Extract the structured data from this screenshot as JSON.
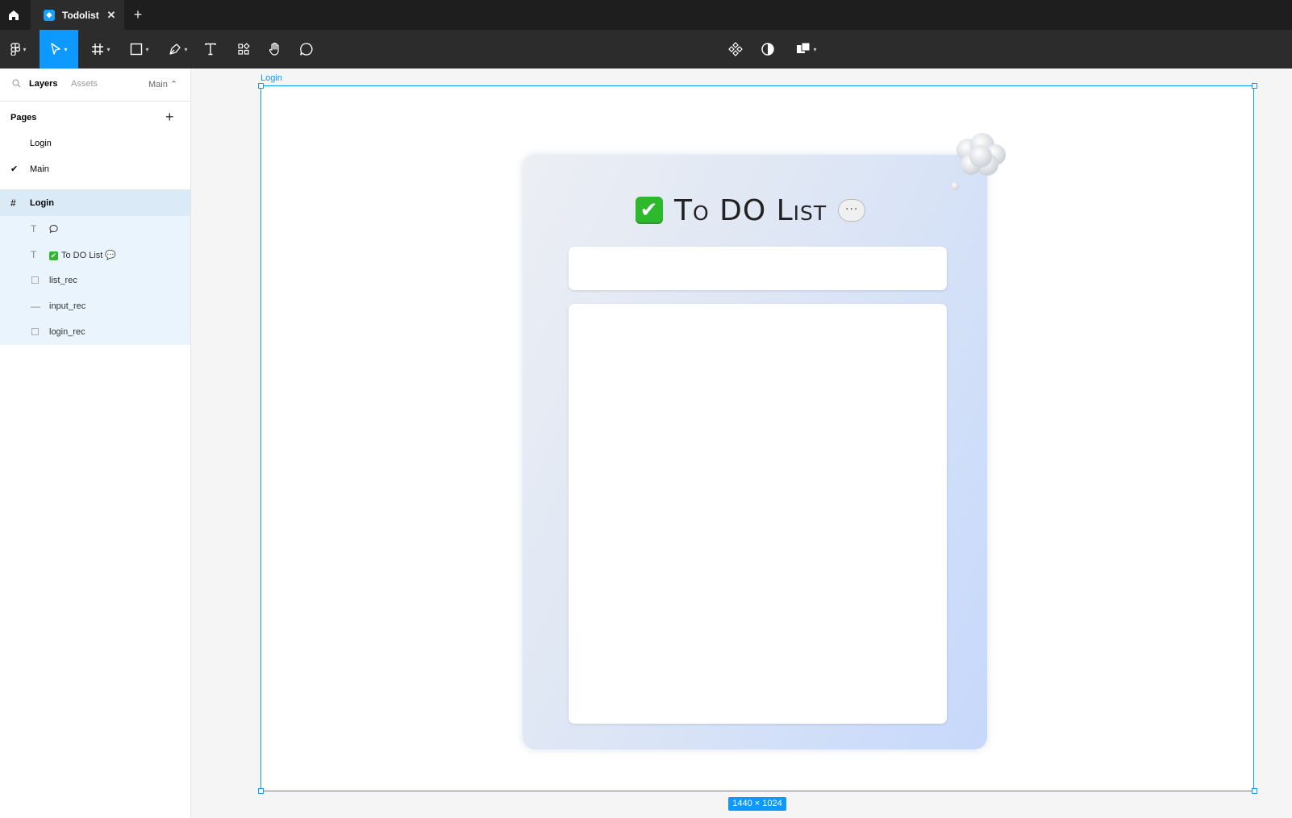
{
  "titlebar": {
    "tab_title": "Todolist",
    "close_glyph": "✕",
    "new_tab_glyph": "+"
  },
  "toolbar": {
    "tools": [
      "main-menu",
      "move-tool",
      "frame-tool",
      "shape-tool",
      "pen-tool",
      "text-tool",
      "resources-tool",
      "hand-tool",
      "comment-tool"
    ],
    "right_tools": [
      "components-icon",
      "mask-icon",
      "boolean-icon"
    ]
  },
  "left_panel": {
    "tabs": {
      "layers": "Layers",
      "assets": "Assets",
      "page_selector": "Main ⌃"
    },
    "pages_heading": "Pages",
    "add_page_glyph": "+",
    "pages": [
      {
        "label": "Login",
        "current": false
      },
      {
        "label": "Main",
        "current": true
      }
    ],
    "layers": {
      "frame": "Login",
      "children": [
        {
          "type": "text",
          "label": "💭"
        },
        {
          "type": "text",
          "label": "To DO List 💬",
          "prefix": "✔"
        },
        {
          "type": "rect",
          "label": "list_rec"
        },
        {
          "type": "line",
          "label": "input_rec"
        },
        {
          "type": "rect",
          "label": "login_rec"
        }
      ]
    }
  },
  "canvas": {
    "frame_label": "Login",
    "frame_size": "1440 × 1024",
    "title": "To DO List",
    "title_check": "✔",
    "title_bubble": "···",
    "colors": {
      "selection": "#0d99ff",
      "card_start": "#eceef3",
      "card_end": "#c6d8fb"
    }
  }
}
